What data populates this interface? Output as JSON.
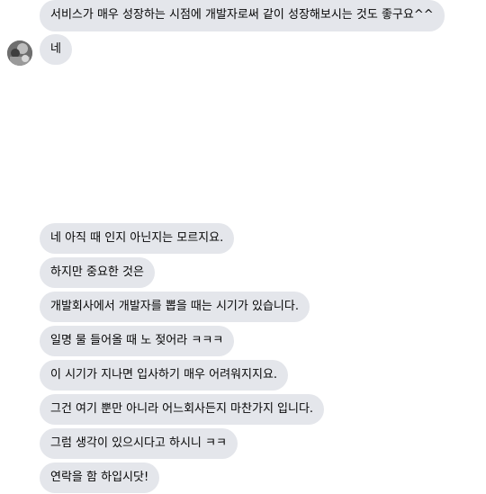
{
  "thread": {
    "top_messages": [
      "서비스가 매우 성장하는 시점에 개발자로써 같이 성장해보시는 것도 좋구요^^",
      "네"
    ],
    "bottom_messages": [
      "네 아직 때 인지 아닌지는 모르지요.",
      "하지만 중요한 것은",
      "개발회사에서 개발자를 뽑을 때는 시기가 있습니다.",
      "일명 물 들어올 때 노 젖어라 ㅋㅋㅋ",
      "이 시기가 지나면 입사하기 매우 어려워지지요.",
      "그건 여기 뿐만 아니라 어느회사든지 마찬가지 입니다.",
      "그럼 생각이 있으시다고 하시니 ㅋㅋ",
      "연락을 함 하입시닷!"
    ]
  },
  "colors": {
    "bubble": "#e4e6eb",
    "text": "#050505",
    "background": "#ffffff"
  },
  "icons": {
    "sender_avatar": "avatar"
  }
}
